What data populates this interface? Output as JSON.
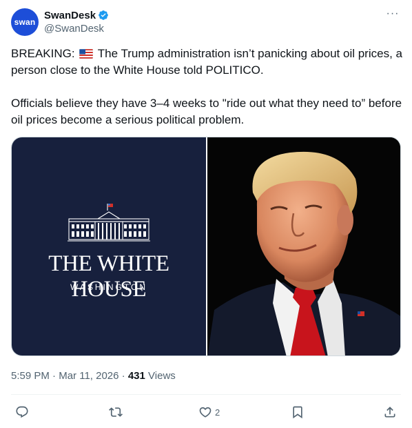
{
  "account": {
    "avatar_text": "swan",
    "display_name": "SwanDesk",
    "handle": "@SwanDesk",
    "verified": true
  },
  "tweet": {
    "line1_prefix": "BREAKING:",
    "line1_rest": "The Trump administration isn’t panicking about oil prices, a person close to the White House told POLITICO.",
    "line2": "Officials believe they have 3–4 weeks to \"ride out what they need to” before oil prices become a serious political problem."
  },
  "media": {
    "left_title": "THE WHITE HOUSE",
    "left_subtitle": "WASHINGTON"
  },
  "meta": {
    "time": "5:59 PM",
    "dot1": "·",
    "date": "Mar 11, 2026",
    "dot2": "·",
    "views_count": "431",
    "views_label": "Views"
  },
  "actions": {
    "reply_icon": "reply-icon",
    "repost_icon": "repost-icon",
    "like_icon": "heart-icon",
    "like_count": "2",
    "bookmark_icon": "bookmark-icon",
    "share_icon": "share-icon"
  },
  "colors": {
    "accent": "#1d9bf0",
    "text": "#0f1419",
    "secondary": "#536471",
    "wh_navy": "#17203d"
  }
}
